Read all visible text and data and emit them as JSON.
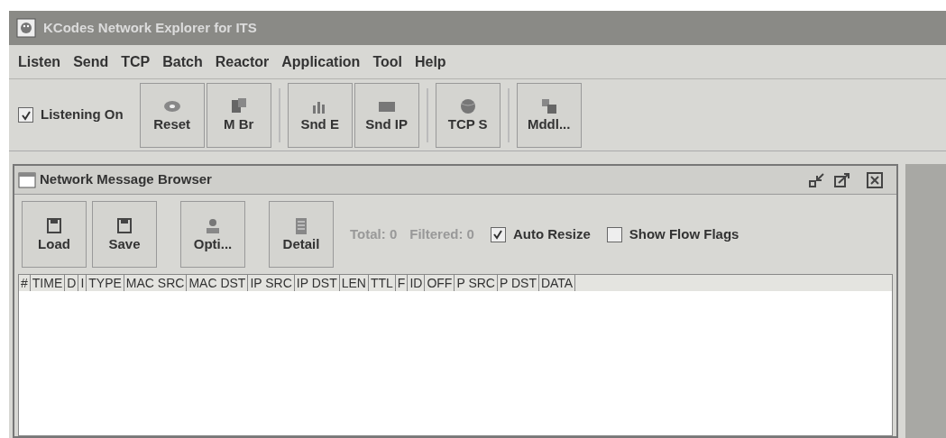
{
  "window": {
    "title": "KCodes Network Explorer for ITS"
  },
  "menu": [
    "Listen",
    "Send",
    "TCP",
    "Batch",
    "Reactor",
    "Application",
    "Tool",
    "Help"
  ],
  "toolbar": {
    "listening": {
      "label": "Listening On",
      "checked": true
    },
    "groups": [
      [
        {
          "label": "Reset",
          "kind": "disc"
        },
        {
          "label": "M Br",
          "kind": "windows"
        }
      ],
      [
        {
          "label": "Snd E",
          "kind": "chart"
        },
        {
          "label": "Snd IP",
          "kind": "card"
        }
      ],
      [
        {
          "label": "TCP S",
          "kind": "globe"
        }
      ],
      [
        {
          "label": "Mddl...",
          "kind": "tool"
        }
      ]
    ]
  },
  "browser": {
    "title": "Network Message Browser",
    "buttons": [
      {
        "label": "Load",
        "kind": "floppy"
      },
      {
        "label": "Save",
        "kind": "floppy"
      },
      {
        "label": "Opti...",
        "kind": "person"
      },
      {
        "label": "Detail",
        "kind": "doc"
      }
    ],
    "total": "Total: 0",
    "filtered": "Filtered: 0",
    "options": [
      {
        "label": "Auto Resize",
        "checked": true
      },
      {
        "label": "Show Flow Flags",
        "checked": false
      }
    ],
    "columns": [
      "#",
      "TIME",
      "D",
      "I",
      "TYPE",
      "MAC SRC",
      "MAC DST",
      "IP SRC",
      "IP DST",
      "LEN",
      "TTL",
      "F",
      "ID",
      "OFF",
      "P SRC",
      "P DST",
      "DATA"
    ]
  }
}
